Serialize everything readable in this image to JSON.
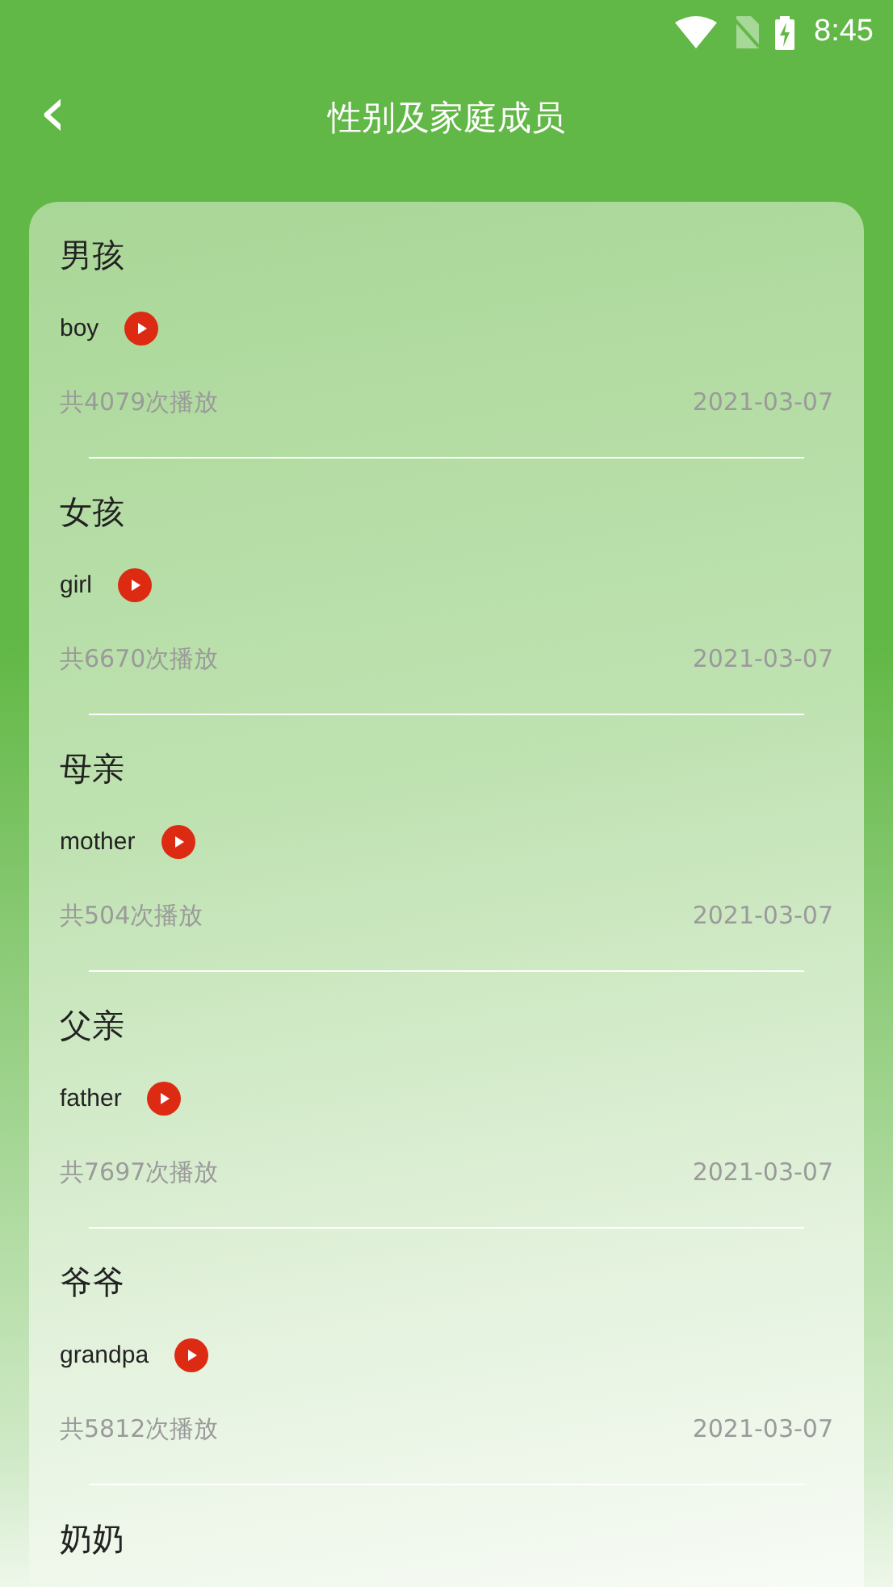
{
  "status_bar": {
    "time": "8:45"
  },
  "header": {
    "back": "‹",
    "title": "性别及家庭成员"
  },
  "words": [
    {
      "title": "男孩",
      "english": "boy",
      "plays": "共4079次播放",
      "date": "2021-03-07"
    },
    {
      "title": "女孩",
      "english": "girl",
      "plays": "共6670次播放",
      "date": "2021-03-07"
    },
    {
      "title": "母亲",
      "english": "mother",
      "plays": "共504次播放",
      "date": "2021-03-07"
    },
    {
      "title": "父亲",
      "english": "father",
      "plays": "共7697次播放",
      "date": "2021-03-07"
    },
    {
      "title": "爷爷",
      "english": "grandpa",
      "plays": "共5812次播放",
      "date": "2021-03-07"
    },
    {
      "title": "奶奶"
    }
  ]
}
